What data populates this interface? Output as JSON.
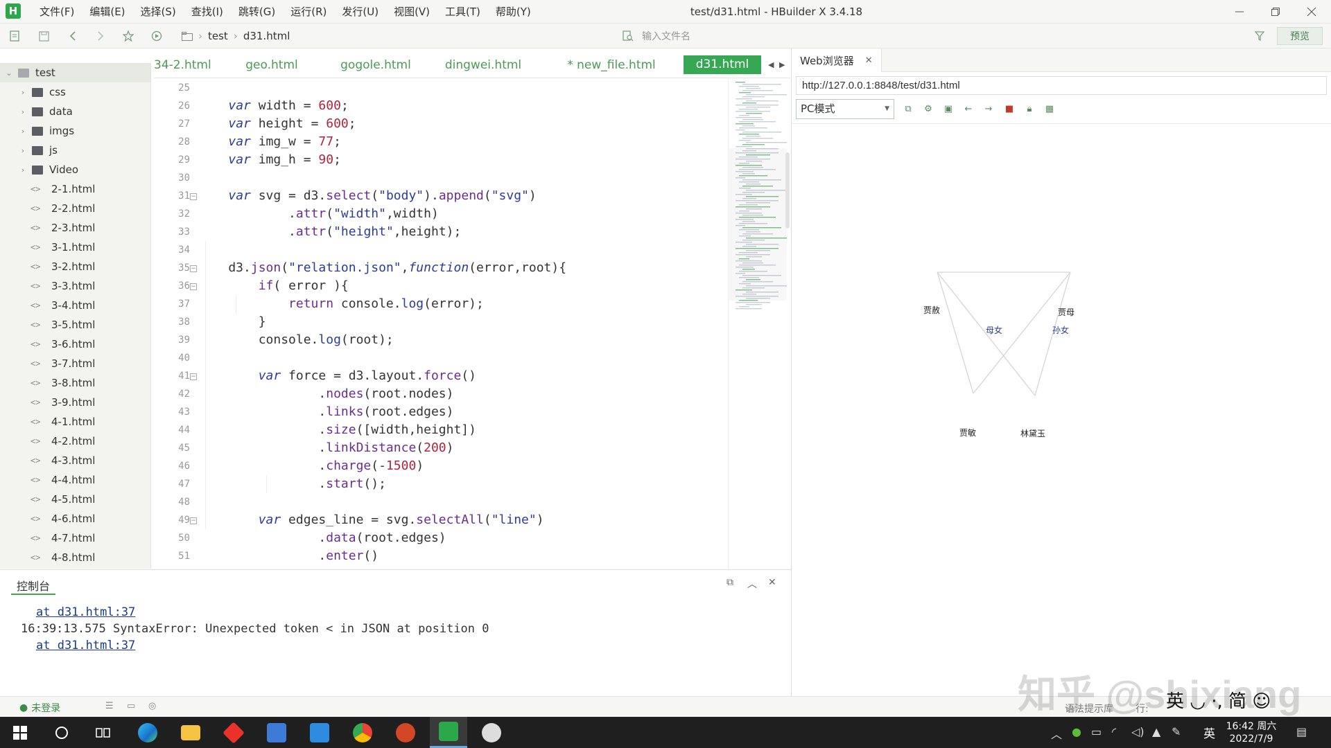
{
  "window": {
    "title": "test/d31.html - HBuilder X 3.4.18",
    "logo_letter": "H"
  },
  "menu": [
    "文件(F)",
    "编辑(E)",
    "选择(S)",
    "查找(I)",
    "跳转(G)",
    "运行(R)",
    "发行(U)",
    "视图(V)",
    "工具(T)",
    "帮助(Y)"
  ],
  "toolbar": {
    "breadcrumb": [
      "test",
      "d31.html"
    ],
    "file_search_placeholder": "输入文件名",
    "preview_label": "预览"
  },
  "sidebar": {
    "root": "test",
    "folders": [
      "css",
      "data",
      "imgs",
      "js",
      "Video"
    ],
    "files": [
      "2-1.html",
      "2-2.html",
      "2-3.html",
      "3-1.html",
      "3-2.html",
      "3-3.html",
      "3-4.html",
      "3-5.html",
      "3-6.html",
      "3-7.html",
      "3-8.html",
      "3-9.html",
      "4-1.html",
      "4-2.html",
      "4-3.html",
      "4-4.html",
      "4-5.html",
      "4-6.html",
      "4-7.html",
      "4-8.html"
    ]
  },
  "tabs": [
    {
      "label": "34-2.html",
      "active": false
    },
    {
      "label": "geo.html",
      "active": false
    },
    {
      "label": "gogole.html",
      "active": false
    },
    {
      "label": "dingwei.html",
      "active": false
    },
    {
      "label": "* new_file.html",
      "active": false
    },
    {
      "label": "d31.html",
      "active": true
    }
  ],
  "editor": {
    "first_line": 25,
    "folds": [
      31,
      35,
      36,
      41,
      49
    ],
    "lines": [
      [],
      [
        [
          "    ",
          "plain"
        ],
        [
          "var",
          "kw"
        ],
        [
          " width = ",
          "plain"
        ],
        [
          "600",
          "num"
        ],
        [
          ";",
          "plain"
        ]
      ],
      [
        [
          "    ",
          "plain"
        ],
        [
          "var",
          "kw"
        ],
        [
          " height = ",
          "plain"
        ],
        [
          "600",
          "num"
        ],
        [
          ";",
          "plain"
        ]
      ],
      [
        [
          "    ",
          "plain"
        ],
        [
          "var",
          "kw"
        ],
        [
          " img_w = ",
          "plain"
        ],
        [
          "77",
          "num"
        ],
        [
          ";",
          "plain"
        ]
      ],
      [
        [
          "    ",
          "plain"
        ],
        [
          "var",
          "kw"
        ],
        [
          " img_h = ",
          "plain"
        ],
        [
          "90",
          "num"
        ],
        [
          ";",
          "plain"
        ]
      ],
      [],
      [
        [
          "    ",
          "plain"
        ],
        [
          "var",
          "kw"
        ],
        [
          " svg = d3.",
          "plain"
        ],
        [
          "select",
          "fn"
        ],
        [
          "(",
          "plain"
        ],
        [
          "\"body\"",
          "str"
        ],
        [
          ").",
          "plain"
        ],
        [
          "append",
          "fn"
        ],
        [
          "(",
          "plain"
        ],
        [
          "\"svg\"",
          "str"
        ],
        [
          ")",
          "plain"
        ]
      ],
      [
        [
          "            .",
          "plain"
        ],
        [
          "attr",
          "fn"
        ],
        [
          "(",
          "plain"
        ],
        [
          "\"width\"",
          "str"
        ],
        [
          ",width)",
          "plain"
        ]
      ],
      [
        [
          "            .",
          "plain"
        ],
        [
          "attr",
          "fn"
        ],
        [
          "(",
          "plain"
        ],
        [
          "\"height\"",
          "str"
        ],
        [
          ",height);",
          "plain"
        ]
      ],
      [],
      [
        [
          "    d3.",
          "plain"
        ],
        [
          "json",
          "fn"
        ],
        [
          "(",
          "plain"
        ],
        [
          "\"relation.json\"",
          "str"
        ],
        [
          ",",
          "plain"
        ],
        [
          "function",
          "kw"
        ],
        [
          "(error,root){",
          "plain"
        ]
      ],
      [
        [
          "        ",
          "plain"
        ],
        [
          "if",
          "fn"
        ],
        [
          "( error ){",
          "plain"
        ]
      ],
      [
        [
          "            ",
          "plain"
        ],
        [
          "return",
          "fn"
        ],
        [
          " console.",
          "plain"
        ],
        [
          "log",
          "str"
        ],
        [
          "(error);",
          "plain"
        ]
      ],
      [
        [
          "        }",
          "plain"
        ]
      ],
      [
        [
          "        console.",
          "plain"
        ],
        [
          "log",
          "str"
        ],
        [
          "(root);",
          "plain"
        ]
      ],
      [],
      [
        [
          "        ",
          "plain"
        ],
        [
          "var",
          "kw"
        ],
        [
          " force = d3.layout.",
          "plain"
        ],
        [
          "force",
          "fn"
        ],
        [
          "()",
          "plain"
        ]
      ],
      [
        [
          "                .",
          "plain"
        ],
        [
          "nodes",
          "fn"
        ],
        [
          "(root.nodes)",
          "plain"
        ]
      ],
      [
        [
          "                .",
          "plain"
        ],
        [
          "links",
          "fn"
        ],
        [
          "(root.edges)",
          "plain"
        ]
      ],
      [
        [
          "                .",
          "plain"
        ],
        [
          "size",
          "fn"
        ],
        [
          "([width,height])",
          "plain"
        ]
      ],
      [
        [
          "                .",
          "plain"
        ],
        [
          "linkDistance",
          "fn"
        ],
        [
          "(",
          "plain"
        ],
        [
          "200",
          "num"
        ],
        [
          ")",
          "plain"
        ]
      ],
      [
        [
          "                .",
          "plain"
        ],
        [
          "charge",
          "fn"
        ],
        [
          "(-",
          "plain"
        ],
        [
          "1500",
          "num"
        ],
        [
          ")",
          "plain"
        ]
      ],
      [
        [
          "                .",
          "plain"
        ],
        [
          "start",
          "fn"
        ],
        [
          "();",
          "plain"
        ]
      ],
      [],
      [
        [
          "        ",
          "plain"
        ],
        [
          "var",
          "kw"
        ],
        [
          " edges_line = svg.",
          "plain"
        ],
        [
          "selectAll",
          "fn"
        ],
        [
          "(",
          "plain"
        ],
        [
          "\"line\"",
          "str"
        ],
        [
          ")",
          "plain"
        ]
      ],
      [
        [
          "                .",
          "plain"
        ],
        [
          "data",
          "fn"
        ],
        [
          "(root.edges)",
          "plain"
        ]
      ],
      [
        [
          "                .",
          "plain"
        ],
        [
          "enter",
          "fn"
        ],
        [
          "()",
          "plain"
        ]
      ]
    ]
  },
  "browser": {
    "tab_label": "Web浏览器",
    "url": "http://127.0.0.1:8848/test/d31.html",
    "mode": "PC模式",
    "graph_labels": {
      "jiashe": "贾赦",
      "jiamu": "贾母",
      "jiamin": "贾敏",
      "daiyu": "林黛玉",
      "edge_munv": "母女",
      "edge_sunnv": "孙女"
    }
  },
  "console": {
    "title": "控制台",
    "lines": [
      {
        "text": "at d31.html:37",
        "link": true
      },
      {
        "text": "16:39:13.575 SyntaxError: Unexpected token < in JSON at position 0",
        "link": false
      },
      {
        "text": "at d31.html:37",
        "link": true
      }
    ]
  },
  "status": {
    "login": "未登录",
    "hint": "语法提示库",
    "row_label": "行:"
  },
  "taskbar": {
    "time": "16:42 周六",
    "date": "2022/7/9",
    "ime_lang": "英"
  },
  "watermark": "知乎 @shixiang",
  "ime_bar": "英 ◡ ·, 简 ☺",
  "colors": {
    "accent": "#36a853",
    "code_keyword": "#2d3a9a",
    "code_number": "#b0243c"
  }
}
